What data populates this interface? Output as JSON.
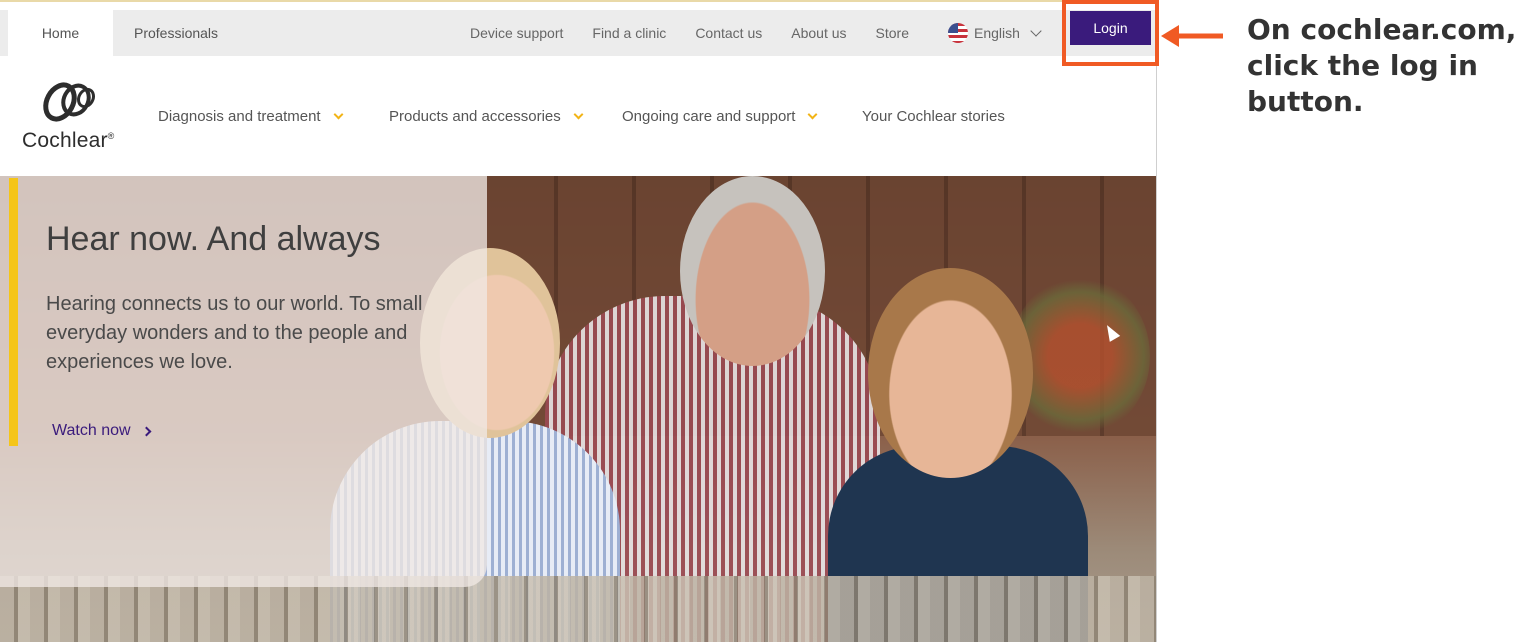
{
  "utility_bar": {
    "tabs": [
      {
        "label": "Home"
      },
      {
        "label": "Professionals"
      }
    ],
    "links": [
      {
        "label": "Device support"
      },
      {
        "label": "Find a clinic"
      },
      {
        "label": "Contact us"
      },
      {
        "label": "About us"
      },
      {
        "label": "Store"
      }
    ],
    "language": {
      "label": "English",
      "icon": "us-flag-icon"
    },
    "login_label": "Login"
  },
  "main_nav": {
    "logo_text": "Cochlear",
    "logo_mark": "®",
    "items": [
      {
        "label": "Diagnosis and treatment",
        "has_dropdown": true
      },
      {
        "label": "Products and accessories",
        "has_dropdown": true
      },
      {
        "label": "Ongoing care and support",
        "has_dropdown": true
      },
      {
        "label": "Your Cochlear stories",
        "has_dropdown": false
      }
    ]
  },
  "hero": {
    "title": "Hear now. And always",
    "text": "Hearing connects us to our world. To small everyday wonders and to the people and experiences we love.",
    "cta_label": "Watch now"
  },
  "annotation": {
    "instruction": "On cochlear.com, click the log in button."
  },
  "colors": {
    "brand_purple": "#3a1b7c",
    "accent_yellow": "#f5c518",
    "highlight_orange": "#f05a24"
  }
}
